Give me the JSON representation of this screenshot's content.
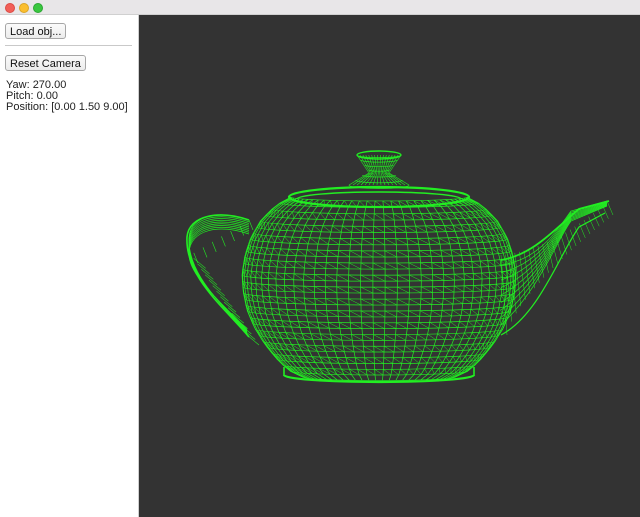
{
  "window": {
    "traffic_lights": [
      "close",
      "minimize",
      "maximize"
    ]
  },
  "sidebar": {
    "load_button": "Load obj...",
    "reset_button": "Reset Camera",
    "yaw": "Yaw: 270.00",
    "pitch": "Pitch: 0.00",
    "position": "Position: [0.00 1.50 9.00]"
  },
  "viewport": {
    "background": "#333333",
    "wire_color": "#22ee22",
    "model": "teapot-wireframe"
  }
}
